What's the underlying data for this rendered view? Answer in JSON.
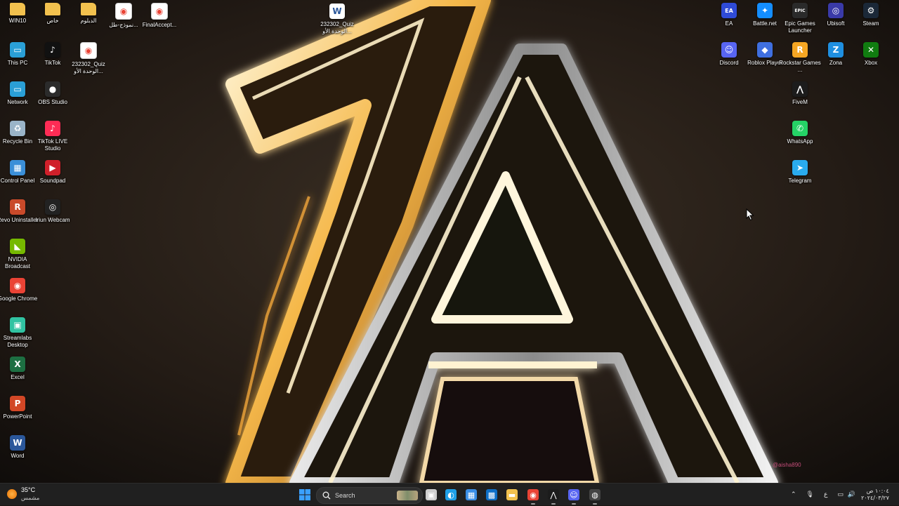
{
  "desktop": {
    "left_icons": [
      {
        "label": "WIN10",
        "icon": "folder-icon",
        "color": "#f2c14e"
      },
      {
        "label": "خاص",
        "icon": "folder-icon",
        "color": "#f2c14e"
      },
      {
        "label": "الدبلوم",
        "icon": "folder-icon",
        "color": "#f2c14e"
      },
      {
        "label": "نموذج-طل...",
        "icon": "chrome-html-file-icon",
        "color": "#ffffff"
      },
      {
        "label": "FinalAccept...",
        "icon": "chrome-html-file-icon",
        "color": "#ffffff"
      },
      {
        "label": "This PC",
        "icon": "monitor-icon",
        "color": "#2a9fd6"
      },
      {
        "label": "TikTok",
        "icon": "tiktok-icon",
        "color": "#111111"
      },
      {
        "label": "232302_Quiz الوحدة الأو...",
        "icon": "chrome-html-file-icon",
        "color": "#ffffff"
      },
      {
        "label": "Network",
        "icon": "network-icon",
        "color": "#2a9fd6"
      },
      {
        "label": "OBS Studio",
        "icon": "obs-icon",
        "color": "#2b2b2b"
      },
      {
        "label": "Recycle Bin",
        "icon": "recycle-bin-icon",
        "color": "#9ab4c8"
      },
      {
        "label": "TikTok LIVE Studio",
        "icon": "tiktok-live-icon",
        "color": "#fe2c55"
      },
      {
        "label": "Control Panel",
        "icon": "control-panel-icon",
        "color": "#3b8fd8"
      },
      {
        "label": "Soundpad",
        "icon": "soundpad-icon",
        "color": "#d0202a"
      },
      {
        "label": "Revo Uninstaller",
        "icon": "revo-icon",
        "color": "#c94a2a"
      },
      {
        "label": "Iriun Webcam",
        "icon": "webcam-icon",
        "color": "#222222"
      },
      {
        "label": "NVIDIA Broadcast",
        "icon": "nvidia-icon",
        "color": "#76b900"
      },
      {
        "label": "Google Chrome",
        "icon": "chrome-icon",
        "color": "#ea4335"
      },
      {
        "label": "Streamlabs Desktop",
        "icon": "streamlabs-icon",
        "color": "#31c3a2"
      },
      {
        "label": "Excel",
        "icon": "excel-icon",
        "color": "#1d6f42"
      },
      {
        "label": "PowerPoint",
        "icon": "powerpoint-icon",
        "color": "#d24726"
      },
      {
        "label": "Word",
        "icon": "word-icon",
        "color": "#2b579a"
      }
    ],
    "center_icon": {
      "label": "232302_Quiz الوحدة الأو...",
      "icon": "word-document-icon",
      "color": "#2b579a"
    },
    "right_icons": [
      {
        "label": "EA",
        "icon": "ea-icon",
        "color": "#2f4bd6"
      },
      {
        "label": "Battle.net",
        "icon": "battlenet-icon",
        "color": "#148eff"
      },
      {
        "label": "Epic Games Launcher",
        "icon": "epic-games-icon",
        "color": "#2a2a2a"
      },
      {
        "label": "Ubisoft",
        "icon": "ubisoft-icon",
        "color": "#3a3aa8"
      },
      {
        "label": "Steam",
        "icon": "steam-icon",
        "color": "#1b2838"
      },
      {
        "label": "Discord",
        "icon": "discord-icon",
        "color": "#5865f2"
      },
      {
        "label": "Roblox Player",
        "icon": "roblox-icon",
        "color": "#3f6fe0"
      },
      {
        "label": "Rockstar Games ...",
        "icon": "rockstar-icon",
        "color": "#f5a623"
      },
      {
        "label": "Zona",
        "icon": "zona-icon",
        "color": "#1f8fe0"
      },
      {
        "label": "Xbox",
        "icon": "xbox-icon",
        "color": "#107c10"
      },
      {
        "label": "FiveM",
        "icon": "fivem-icon",
        "color": "#1c1c1c"
      },
      {
        "label": "WhatsApp",
        "icon": "whatsapp-icon",
        "color": "#25d366"
      },
      {
        "label": "Telegram",
        "icon": "telegram-icon",
        "color": "#2aabee"
      }
    ],
    "watermark": "@aisha890"
  },
  "taskbar": {
    "weather": {
      "temp": "35°C",
      "condition": "مشمس"
    },
    "search_placeholder": "Search",
    "pinned": [
      {
        "icon": "start-icon",
        "color": "#3aa0ff"
      },
      {
        "icon": "task-view-icon",
        "color": "#cfcfcf"
      },
      {
        "icon": "edge-icon",
        "color": "#1fa0e8"
      },
      {
        "icon": "microsoft-store-icon",
        "color": "#3a8ee6"
      },
      {
        "icon": "photos-icon",
        "color": "#0e6fc7"
      },
      {
        "icon": "file-explorer-icon",
        "color": "#f2c14e"
      },
      {
        "icon": "chrome-icon",
        "color": "#ea4335"
      },
      {
        "icon": "fivem-icon",
        "color": "#1c1c1c"
      },
      {
        "icon": "discord-icon",
        "color": "#5865f2"
      },
      {
        "icon": "obs-recording-icon",
        "color": "#444444"
      }
    ],
    "tray": {
      "language": "ع",
      "time": "١٠:٠٤ ص",
      "date": "٢٠٢٤/٠٣/٢٧"
    }
  }
}
